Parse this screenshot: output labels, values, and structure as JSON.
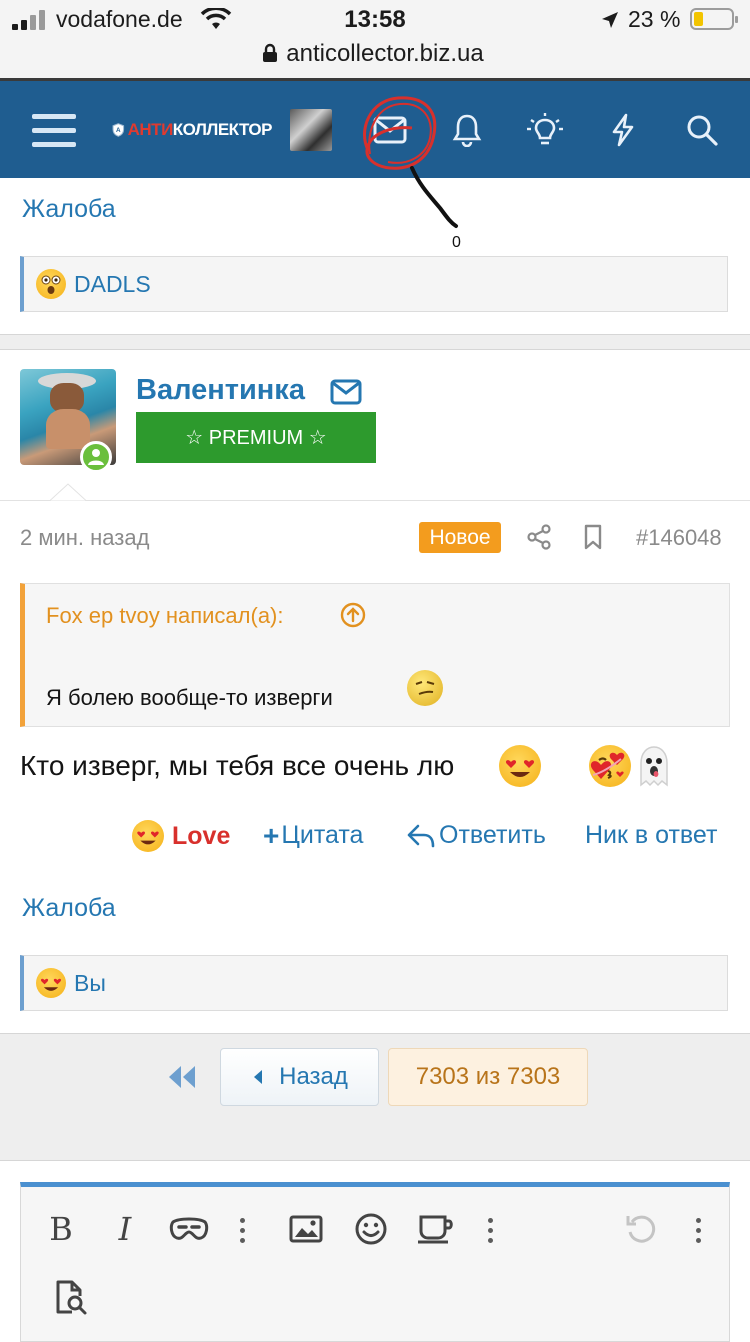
{
  "status_bar": {
    "carrier": "vodafone.de",
    "time": "13:58",
    "battery_percent": "23 %",
    "battery_level": 0.23,
    "url": "anticollector.biz.ua"
  },
  "nav": {
    "logo_text_left": "АНТИ",
    "logo_text_right": "КОЛЛЕКТОР"
  },
  "annotation": {
    "number": "0",
    "color": "#d8302c"
  },
  "post1": {
    "report_label": "Жалоба",
    "reaction_text": "DADLS"
  },
  "post2": {
    "username": "Валентинка",
    "badge": "☆ PREMIUM ☆",
    "badge_color": "#2d9a2d",
    "time": "2 мин. назад",
    "new_label": "Новое",
    "post_number": "#146048",
    "quote_author": "Fox ep tvoy написал(а):",
    "quote_text": "Я болею вообще-то изверги",
    "body_text": "Кто изверг, мы тебя все очень лю",
    "actions": {
      "love": "Love",
      "quote": "Цитата",
      "reply": "Ответить",
      "nick": "Ник в ответ"
    },
    "report_label": "Жалоба",
    "reaction_text": "Вы"
  },
  "pagination": {
    "back_label": "Назад",
    "page_label": "7303 из 7303"
  },
  "editor": {
    "accent": "#4a90d0"
  }
}
